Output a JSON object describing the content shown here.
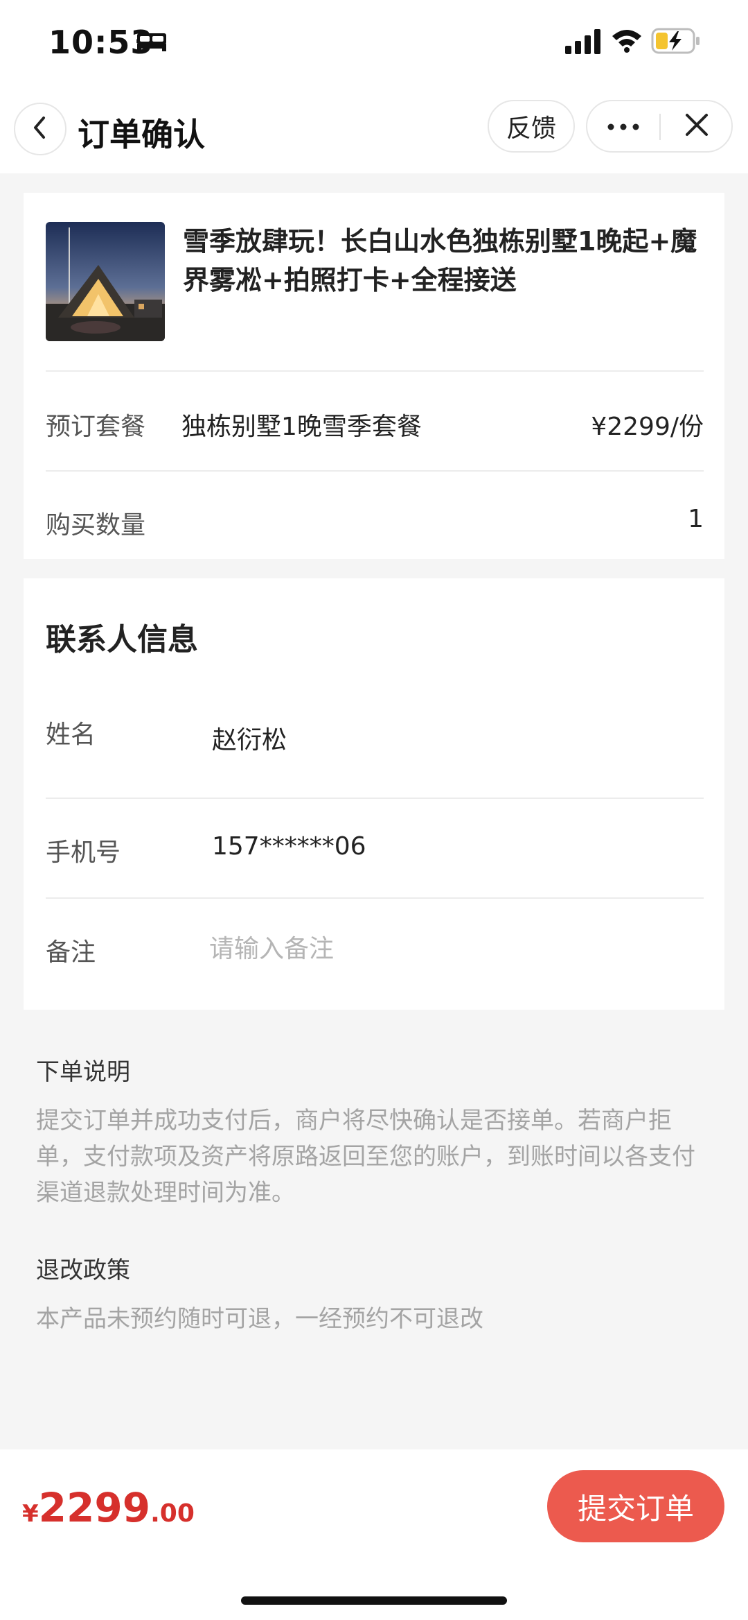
{
  "status_bar": {
    "time": "10:53",
    "icons": [
      "bed-icon",
      "signal-icon",
      "wifi-icon",
      "battery-charging-icon"
    ]
  },
  "nav": {
    "title": "订单确认",
    "feedback_label": "反馈",
    "icons": [
      "chevron-left-icon",
      "more-icon",
      "close-icon"
    ]
  },
  "product": {
    "title": "雪季放肆玩！长白山水色独栋别墅1晚起+魔界雾凇+拍照打卡+全程接送",
    "package_label": "预订套餐",
    "package_value": "独栋别墅1晚雪季套餐",
    "package_price": "¥2299/份",
    "quantity_label": "购买数量",
    "quantity_value": "1"
  },
  "contact": {
    "section_title": "联系人信息",
    "name_label": "姓名",
    "name_value": "赵衍松",
    "phone_label": "手机号",
    "phone_value": "157******06",
    "remark_label": "备注",
    "remark_placeholder": "请输入备注",
    "remark_value": ""
  },
  "notes": {
    "order_heading": "下单说明",
    "order_text": "提交订单并成功支付后，商户将尽快确认是否接单。若商户拒单，支付款项及资产将原路返回至您的账户，到账时间以各支付渠道退款处理时间为准。",
    "refund_heading": "退改政策",
    "refund_text": "本产品未预约随时可退，一经预约不可退改"
  },
  "footer": {
    "currency": "¥",
    "price_int": "2299",
    "price_dec": ".00",
    "submit_label": "提交订单"
  },
  "colors": {
    "accent": "#ec5a4e",
    "price": "#d6302c",
    "background": "#f5f5f5"
  }
}
